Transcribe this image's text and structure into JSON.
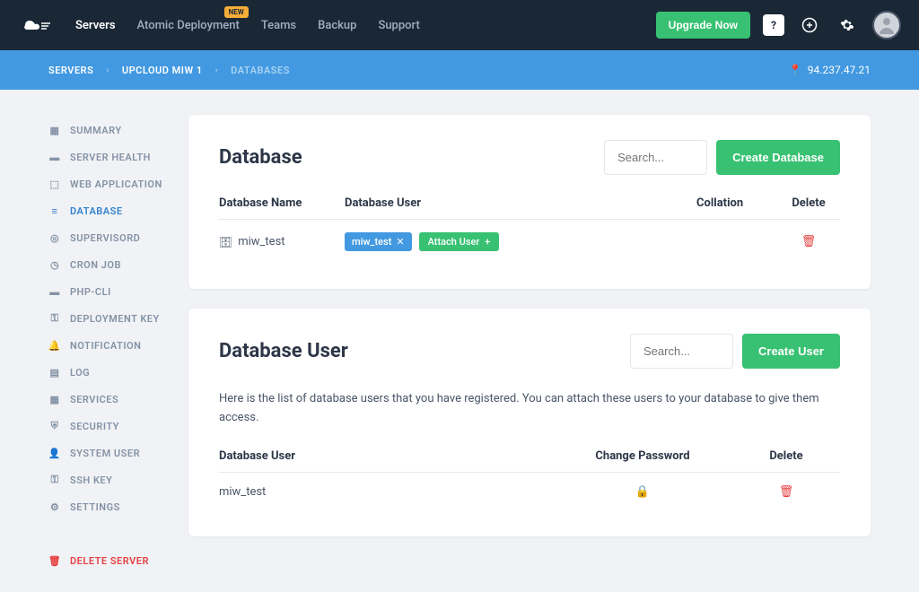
{
  "nav": {
    "links": [
      "Servers",
      "Atomic Deployment",
      "Teams",
      "Backup",
      "Support"
    ],
    "badge": "NEW",
    "upgrade": "Upgrade Now",
    "notif": "?"
  },
  "breadcrumb": {
    "items": [
      "SERVERS",
      "UPCLOUD MIW 1",
      "DATABASES"
    ],
    "ip": "94.237.47.21"
  },
  "sidebar": {
    "items": [
      {
        "icon": "grid",
        "label": "SUMMARY"
      },
      {
        "icon": "heart",
        "label": "SERVER HEALTH"
      },
      {
        "icon": "web",
        "label": "WEB APPLICATION"
      },
      {
        "icon": "db",
        "label": "DATABASE",
        "active": true
      },
      {
        "icon": "super",
        "label": "SUPERVISORD"
      },
      {
        "icon": "clock",
        "label": "CRON JOB"
      },
      {
        "icon": "php",
        "label": "PHP-CLI"
      },
      {
        "icon": "key",
        "label": "DEPLOYMENT KEY"
      },
      {
        "icon": "bell",
        "label": "NOTIFICATION"
      },
      {
        "icon": "log",
        "label": "LOG"
      },
      {
        "icon": "svc",
        "label": "SERVICES"
      },
      {
        "icon": "shield",
        "label": "SECURITY"
      },
      {
        "icon": "user",
        "label": "SYSTEM USER"
      },
      {
        "icon": "key",
        "label": "SSH KEY"
      },
      {
        "icon": "gear",
        "label": "SETTINGS"
      }
    ],
    "delete": "DELETE SERVER"
  },
  "db_panel": {
    "title": "Database",
    "search_ph": "Search...",
    "create": "Create Database",
    "cols": {
      "name": "Database Name",
      "user": "Database User",
      "coll": "Collation",
      "del": "Delete"
    },
    "rows": [
      {
        "name": "miw_test",
        "users": [
          "miw_test"
        ],
        "attach": "Attach User"
      }
    ]
  },
  "user_panel": {
    "title": "Database User",
    "search_ph": "Search...",
    "create": "Create User",
    "desc": "Here is the list of database users that you have registered. You can attach these users to your database to give them access.",
    "cols": {
      "user": "Database User",
      "pwd": "Change Password",
      "del": "Delete"
    },
    "rows": [
      {
        "name": "miw_test"
      }
    ]
  }
}
